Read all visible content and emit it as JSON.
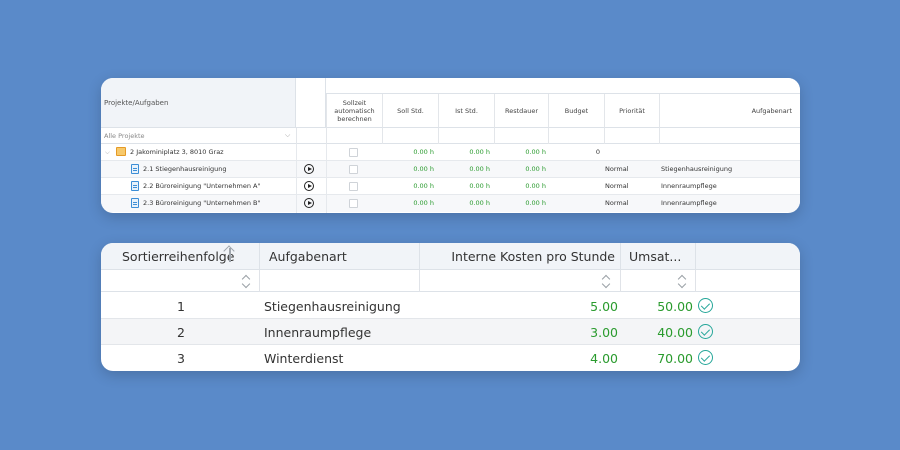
{
  "project_table": {
    "header": {
      "tree_col": "Projekte/Aufgaben",
      "sollzeit": "Sollzeit automatisch berechnen",
      "soll_std": "Soll Std.",
      "ist_std": "Ist Std.",
      "restdauer": "Restdauer",
      "budget": "Budget",
      "prioritaet": "Priorität",
      "aufgabenart": "Aufgabenart"
    },
    "filter": {
      "selected": "Alle Projekte"
    },
    "rows": [
      {
        "name": "2 Jakominiplatz 3, 8010 Graz",
        "icon": "folder-icon",
        "soll": "0.00 h",
        "ist": "0.00 h",
        "rest": "0.00 h",
        "budget": "0",
        "prioritaet": "",
        "aufgabenart": ""
      },
      {
        "name": "2.1 Stiegenhausreinigung",
        "icon": "task-icon",
        "soll": "0.00 h",
        "ist": "0.00 h",
        "rest": "0.00 h",
        "budget": "",
        "prioritaet": "Normal",
        "aufgabenart": "Stiegenhausreinigung"
      },
      {
        "name": "2.2 Büroreinigung \"Unternehmen A\"",
        "icon": "task-icon",
        "soll": "0.00 h",
        "ist": "0.00 h",
        "rest": "0.00 h",
        "budget": "",
        "prioritaet": "Normal",
        "aufgabenart": "Innenraumpflege"
      },
      {
        "name": "2.3 Büroreinigung \"Unternehmen B\"",
        "icon": "task-icon",
        "soll": "0.00 h",
        "ist": "0.00 h",
        "rest": "0.00 h",
        "budget": "",
        "prioritaet": "Normal",
        "aufgabenart": "Innenraumpflege"
      }
    ]
  },
  "task_type_table": {
    "header": {
      "sort": "Sortierreihenfolge",
      "aufgabenart": "Aufgabenart",
      "kosten": "Interne Kosten pro Stunde",
      "umsatz": "Umsat..."
    },
    "rows": [
      {
        "sort": "1",
        "aufgabenart": "Stiegenhausreinigung",
        "kosten": "5.00",
        "umsatz": "50.00"
      },
      {
        "sort": "2",
        "aufgabenart": "Innenraumpflege",
        "kosten": "3.00",
        "umsatz": "40.00"
      },
      {
        "sort": "3",
        "aufgabenart": "Winterdienst",
        "kosten": "4.00",
        "umsatz": "70.00"
      }
    ]
  },
  "colors": {
    "background": "#5a8ac9",
    "value_green": "#2a9b2e",
    "check_teal": "#27a79a",
    "folder": "#f7c96b",
    "task": "#3d8ed6"
  }
}
